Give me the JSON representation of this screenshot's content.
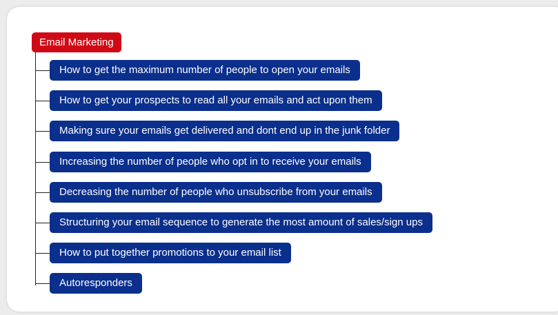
{
  "colors": {
    "root_fill": "#cf0a16",
    "node_fill": "#0a2f8c",
    "connector": "#222222"
  },
  "mindmap": {
    "root": {
      "label": "Email Marketing"
    },
    "children": [
      {
        "label": "How to get the maximum number of people to open your emails"
      },
      {
        "label": "How to get your prospects to read all your emails and act upon them"
      },
      {
        "label": "Making sure your emails get delivered and dont end up in the junk folder"
      },
      {
        "label": "Increasing the number of people who opt in to receive your emails"
      },
      {
        "label": "Decreasing the number of people who unsubscribe from your emails"
      },
      {
        "label": "Structuring your email sequence to generate the most amount of sales/sign ups"
      },
      {
        "label": "How to put together promotions to your email list"
      },
      {
        "label": "Autoresponders"
      }
    ]
  }
}
